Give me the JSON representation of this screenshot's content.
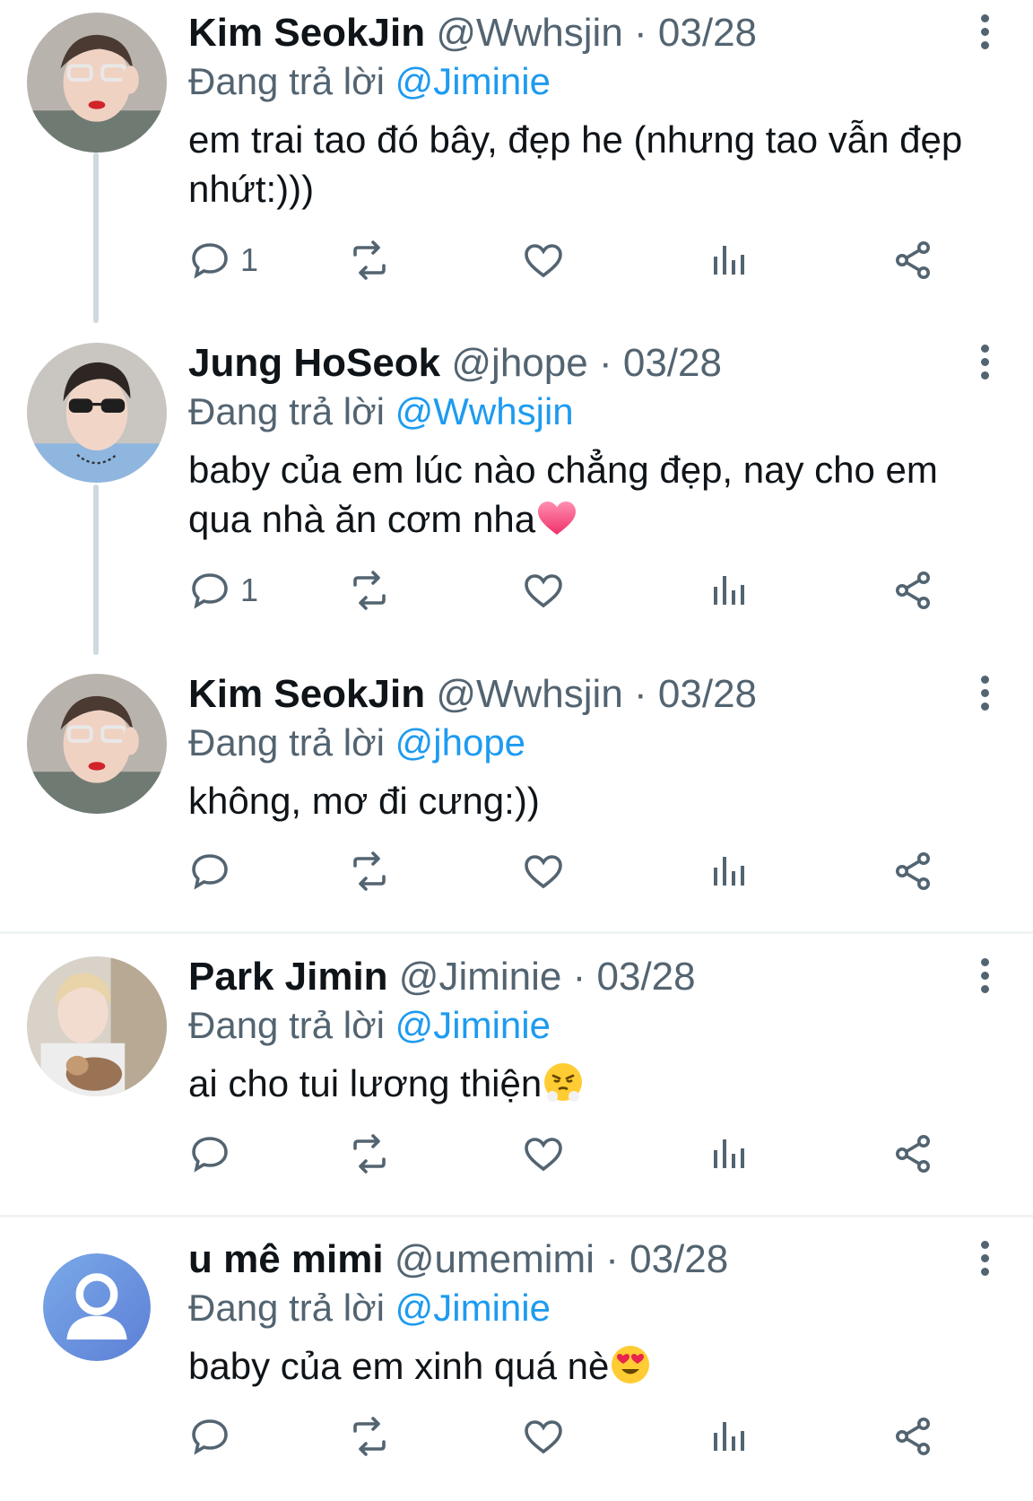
{
  "colors": {
    "accent": "#1d9bf0",
    "text": "#0f1419",
    "secondary": "#536471",
    "divider": "#eff3f4"
  },
  "replying_prefix": "Đang trả lời",
  "separator": "·",
  "tweets": [
    {
      "name": "Kim SeokJin",
      "handle": "@Wwhsjin",
      "date": "03/28",
      "reply_to": "@Jiminie",
      "text": "em trai tao đó bây, đẹp he (nhưng tao vẫn đẹp nhứt:)))",
      "reply_count": "1"
    },
    {
      "name": "Jung HoSeok",
      "handle": "@jhope",
      "date": "03/28",
      "reply_to": "@Wwhsjin",
      "text": "baby của em lúc nào chẳng đẹp, nay cho em qua nhà ăn cơm nha",
      "emoji": "heart-emoji",
      "reply_count": "1"
    },
    {
      "name": "Kim SeokJin",
      "handle": "@Wwhsjin",
      "date": "03/28",
      "reply_to": "@jhope",
      "text": "không, mơ đi cưng:))",
      "reply_count": ""
    },
    {
      "name": "Park Jimin",
      "handle": "@Jiminie",
      "date": "03/28",
      "reply_to": "@Jiminie",
      "text": "ai cho tui lương thiện",
      "emoji": "steam-from-nose-emoji",
      "reply_count": ""
    },
    {
      "name": "u mê mimi",
      "handle": "@umemimi",
      "date": "03/28",
      "reply_to": "@Jiminie",
      "text": "baby của em xinh quá nè",
      "emoji": "heart-eyes-emoji",
      "reply_count": ""
    }
  ]
}
